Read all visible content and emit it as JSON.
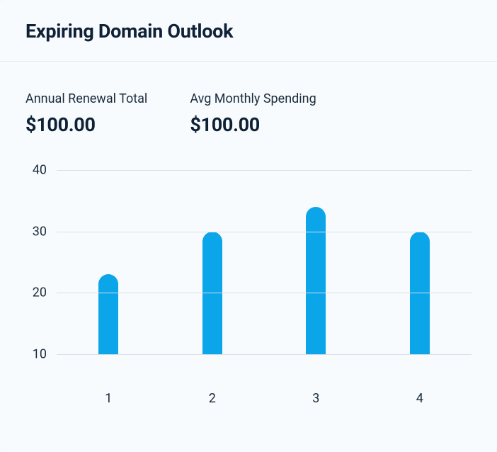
{
  "header": {
    "title": "Expiring Domain Outlook"
  },
  "stats": [
    {
      "label": "Annual Renewal Total",
      "value": "$100.00"
    },
    {
      "label": "Avg Monthly Spending",
      "value": "$100.00"
    }
  ],
  "chart_data": {
    "type": "bar",
    "categories": [
      "1",
      "2",
      "3",
      "4"
    ],
    "values": [
      23,
      30,
      34,
      30
    ],
    "title": "",
    "xlabel": "",
    "ylabel": "",
    "ylim": [
      10,
      40
    ],
    "yticks": [
      10,
      20,
      30,
      40
    ]
  }
}
